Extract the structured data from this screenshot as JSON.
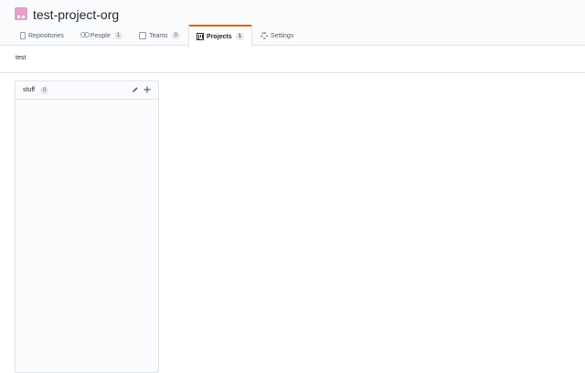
{
  "org": {
    "name": "test-project-org",
    "avatar_color": "#e3a0c8"
  },
  "tabs": [
    {
      "label": "Repositories",
      "icon": "repo-icon"
    },
    {
      "label": "People",
      "count": "1",
      "icon": "people-icon"
    },
    {
      "label": "Teams",
      "count": "0",
      "icon": "teams-icon"
    },
    {
      "label": "Projects",
      "count": "1",
      "icon": "project-icon",
      "selected": true
    },
    {
      "label": "Settings",
      "icon": "gear-icon"
    }
  ],
  "project": {
    "name": "test"
  },
  "columns": [
    {
      "name": "stuff",
      "count": "0"
    }
  ],
  "colors": {
    "accent": "#e36209",
    "border": "#e1e4e8",
    "muted": "#586069"
  }
}
